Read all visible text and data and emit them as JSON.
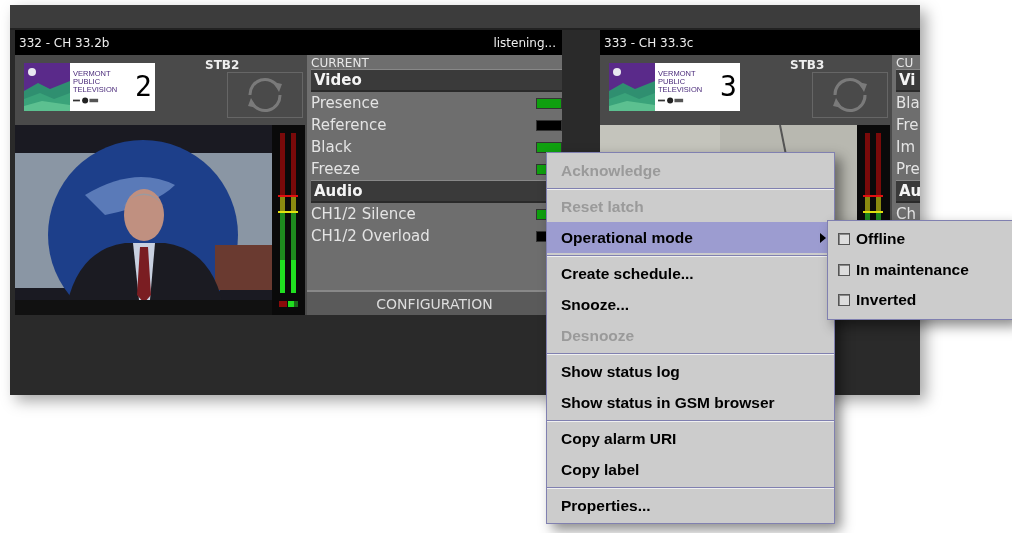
{
  "tiles": [
    {
      "title": "332 - CH 33.2b",
      "status": "listening...",
      "logo": {
        "lines": [
          "VERMONT",
          "PUBLIC",
          "TELEVISION"
        ],
        "number": "2"
      },
      "label": "STB2",
      "panel": {
        "heading": "CURRENT",
        "sections": [
          {
            "title": "Video",
            "rows": [
              {
                "label": "Presence",
                "on": true
              },
              {
                "label": "Reference",
                "on": false
              },
              {
                "label": "Black",
                "on": true
              },
              {
                "label": "Freeze",
                "on": true
              }
            ]
          },
          {
            "title": "Audio",
            "rows": [
              {
                "label": "CH1/2 Silence",
                "on": true
              },
              {
                "label": "CH1/2 Overload",
                "on": false
              }
            ]
          }
        ],
        "footer": "CONFIGURATION"
      }
    },
    {
      "title": "333 - CH 33.3c",
      "logo": {
        "lines": [
          "VERMONT",
          "PUBLIC",
          "TELEVISION"
        ],
        "number": "3"
      },
      "label": "STB3",
      "panel": {
        "heading": "CU",
        "sections": [
          {
            "title": "Vi",
            "rows": [
              {
                "label": "Bla"
              },
              {
                "label": "Fre"
              },
              {
                "label": "Im"
              },
              {
                "label": "Pre"
              }
            ]
          },
          {
            "title": "Au",
            "rows": [
              {
                "label": "Ch"
              }
            ]
          }
        ]
      }
    }
  ],
  "menu": {
    "groups": [
      [
        {
          "label": "Acknowledge",
          "disabled": true,
          "selected": false,
          "submenu": false
        }
      ],
      [
        {
          "label": "Reset latch",
          "disabled": true,
          "selected": false,
          "submenu": false
        },
        {
          "label": "Operational mode",
          "disabled": false,
          "selected": true,
          "submenu": true
        }
      ],
      [
        {
          "label": "Create schedule...",
          "disabled": false,
          "selected": false,
          "submenu": false
        },
        {
          "label": "Snooze...",
          "disabled": false,
          "selected": false,
          "submenu": false
        },
        {
          "label": "Desnooze",
          "disabled": true,
          "selected": false,
          "submenu": false
        }
      ],
      [
        {
          "label": "Show status log",
          "disabled": false,
          "selected": false,
          "submenu": false
        },
        {
          "label": "Show status in GSM browser",
          "disabled": false,
          "selected": false,
          "submenu": false
        }
      ],
      [
        {
          "label": "Copy alarm URI",
          "disabled": false,
          "selected": false,
          "submenu": false
        },
        {
          "label": "Copy label",
          "disabled": false,
          "selected": false,
          "submenu": false
        }
      ],
      [
        {
          "label": "Properties...",
          "disabled": false,
          "selected": false,
          "submenu": false
        }
      ]
    ]
  },
  "submenu": {
    "items": [
      {
        "label": "Offline",
        "checked": false
      },
      {
        "label": "In maintenance",
        "checked": false
      },
      {
        "label": "Inverted",
        "checked": false
      }
    ]
  }
}
